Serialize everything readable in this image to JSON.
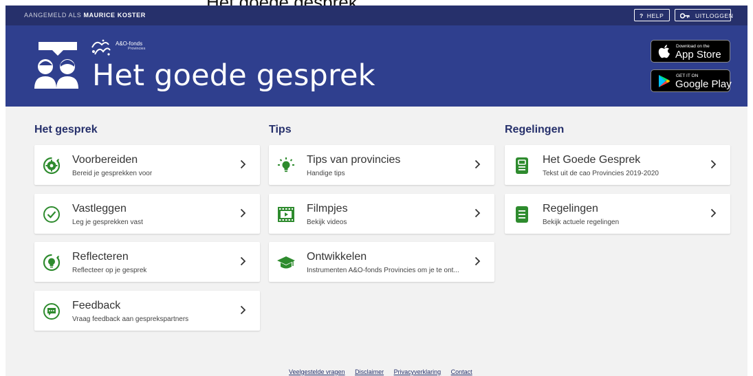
{
  "clipped_title": "Het goede gesprek",
  "topbar": {
    "logged_in_label": "AANGEMELD ALS",
    "user_name": "MAURICE KOSTER",
    "help_icon": "?",
    "help_label": "HELP",
    "logout_label": "UITLOGGEN"
  },
  "hero": {
    "title": "Het goede gesprek",
    "brand_name": "A&O-fonds",
    "brand_sub": "Provincies"
  },
  "stores": {
    "appstore_small": "Download on the",
    "appstore_big": "App Store",
    "googleplay_small": "GET IT ON",
    "googleplay_big": "Google Play"
  },
  "columns": [
    {
      "title": "Het gesprek",
      "cards": [
        {
          "icon": "gear-check-icon",
          "title": "Voorbereiden",
          "subtitle": "Bereid je gesprekken voor"
        },
        {
          "icon": "checkmark-circle-icon",
          "title": "Vastleggen",
          "subtitle": "Leg je gesprekken vast"
        },
        {
          "icon": "lightbulb-circle-icon",
          "title": "Reflecteren",
          "subtitle": "Reflecteer op je gesprek"
        },
        {
          "icon": "chat-bubble-icon",
          "title": "Feedback",
          "subtitle": "Vraag feedback aan gesprekspartners"
        }
      ]
    },
    {
      "title": "Tips",
      "cards": [
        {
          "icon": "lightbulb-icon",
          "title": "Tips van provincies",
          "subtitle": "Handige tips"
        },
        {
          "icon": "film-icon",
          "title": "Filmpjes",
          "subtitle": "Bekijk videos"
        },
        {
          "icon": "graduation-cap-icon",
          "title": "Ontwikkelen",
          "subtitle": "Instrumenten A&O-fonds Provincies om je te ont..."
        }
      ]
    },
    {
      "title": "Regelingen",
      "cards": [
        {
          "icon": "document-icon",
          "title": "Het Goede Gesprek",
          "subtitle": "Tekst uit de cao Provincies 2019-2020"
        },
        {
          "icon": "document-lines-icon",
          "title": "Regelingen",
          "subtitle": "Bekijk actuele regelingen"
        }
      ]
    }
  ],
  "footer": {
    "links": [
      "Veelgestelde vragen",
      "Disclaimer",
      "Privacyverklaring",
      "Contact"
    ]
  },
  "colors": {
    "topbar": "#26306b",
    "hero": "#2f3f8e",
    "accent_green": "#2e8b2e",
    "heading": "#26306b",
    "page_bg": "#f2f2f2"
  }
}
